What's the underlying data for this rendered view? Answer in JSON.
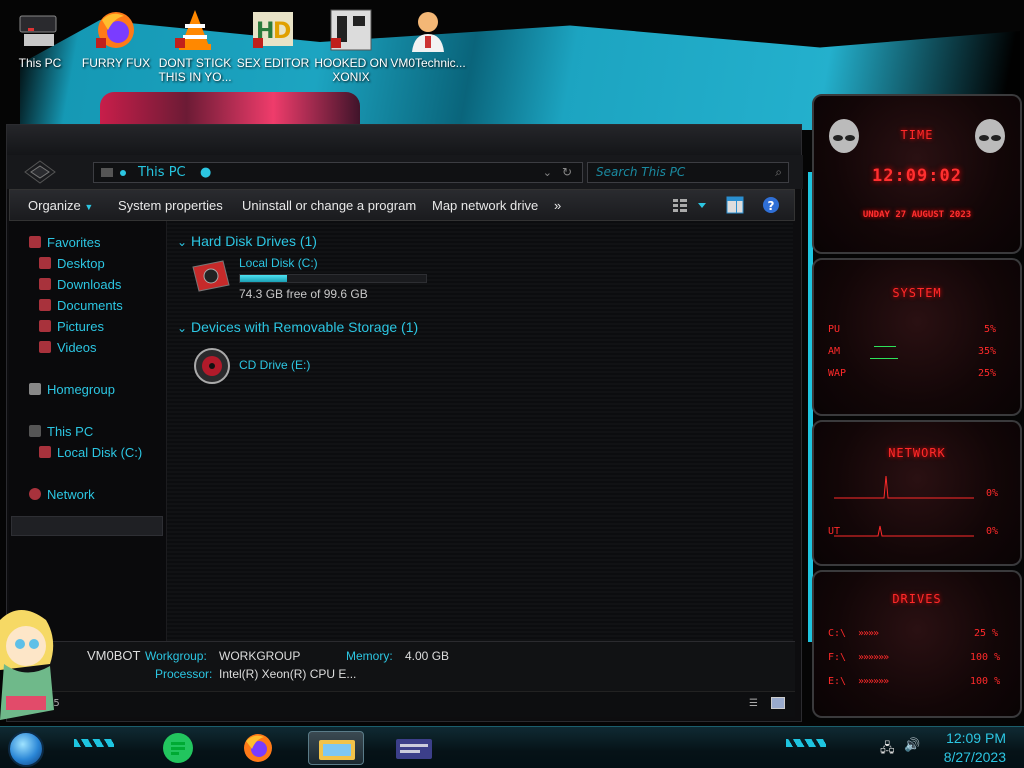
{
  "desktop_icons": [
    {
      "label": "This PC",
      "icon": "computer-icon"
    },
    {
      "label": "FURRY FUX",
      "icon": "firefox-icon"
    },
    {
      "label": "DONT STICK THIS IN YO...",
      "icon": "vlc-icon"
    },
    {
      "label": "SEX EDITOR",
      "icon": "hex-editor-icon"
    },
    {
      "label": "HOOKED ON XONIX",
      "icon": "xonix-game-icon"
    },
    {
      "label": "VM0Technic...",
      "icon": "doctor-icon"
    }
  ],
  "explorer": {
    "address": "This PC",
    "search_placeholder": "Search This PC",
    "toolbar": {
      "organize": "Organize",
      "system_properties": "System properties",
      "uninstall": "Uninstall or change a program",
      "map_drive": "Map network drive",
      "more": "»"
    },
    "nav": {
      "favorites": "Favorites",
      "desktop": "Desktop",
      "downloads": "Downloads",
      "documents": "Documents",
      "pictures": "Pictures",
      "videos": "Videos",
      "homegroup": "Homegroup",
      "this_pc": "This PC",
      "local_disk": "Local Disk (C:)",
      "network": "Network"
    },
    "groups": {
      "hard_disks": "Hard Disk Drives (1)",
      "removable": "Devices with Removable Storage (1)"
    },
    "drives": {
      "c_label": "Local Disk (C:)",
      "c_free": "74.3 GB free of 99.6 GB",
      "c_used_fraction": 0.254,
      "cd_label": "CD Drive (E:)"
    },
    "details": {
      "computer_name": "VM0BOT",
      "workgroup_key": "Workgroup:",
      "workgroup_val": "WORKGROUP",
      "memory_key": "Memory:",
      "memory_val": "4.00 GB",
      "processor_key": "Processor:",
      "processor_val": "Intel(R) Xeon(R) CPU E..."
    },
    "items_count_partial": "15"
  },
  "gadgets": {
    "time_title": "TIME",
    "time": "12:09:02",
    "date": "UNDAY 27 AUGUST 2023",
    "system_title": "SYSTEM",
    "cpu_label": "PU",
    "cpu_val": "5%",
    "ram_label": "AM",
    "ram_val": "35%",
    "swap_label": "WAP",
    "swap_val": "25%",
    "network_title": "NETWORK",
    "net_in_val": "0%",
    "net_out_label": "UT",
    "net_out_val": "0%",
    "drives_title": "DRIVES",
    "drive_c_label": "C:\\",
    "drive_c_val": "25 %",
    "drive_f_label": "F:\\",
    "drive_f_val": "100 %",
    "drive_e_label": "E:\\",
    "drive_e_val": "100 %"
  },
  "taskbar": {
    "time": "12:09 PM",
    "date": "8/27/2023"
  },
  "colors": {
    "accent": "#2cc6e2",
    "gadget_red": "#ff2a2a"
  }
}
